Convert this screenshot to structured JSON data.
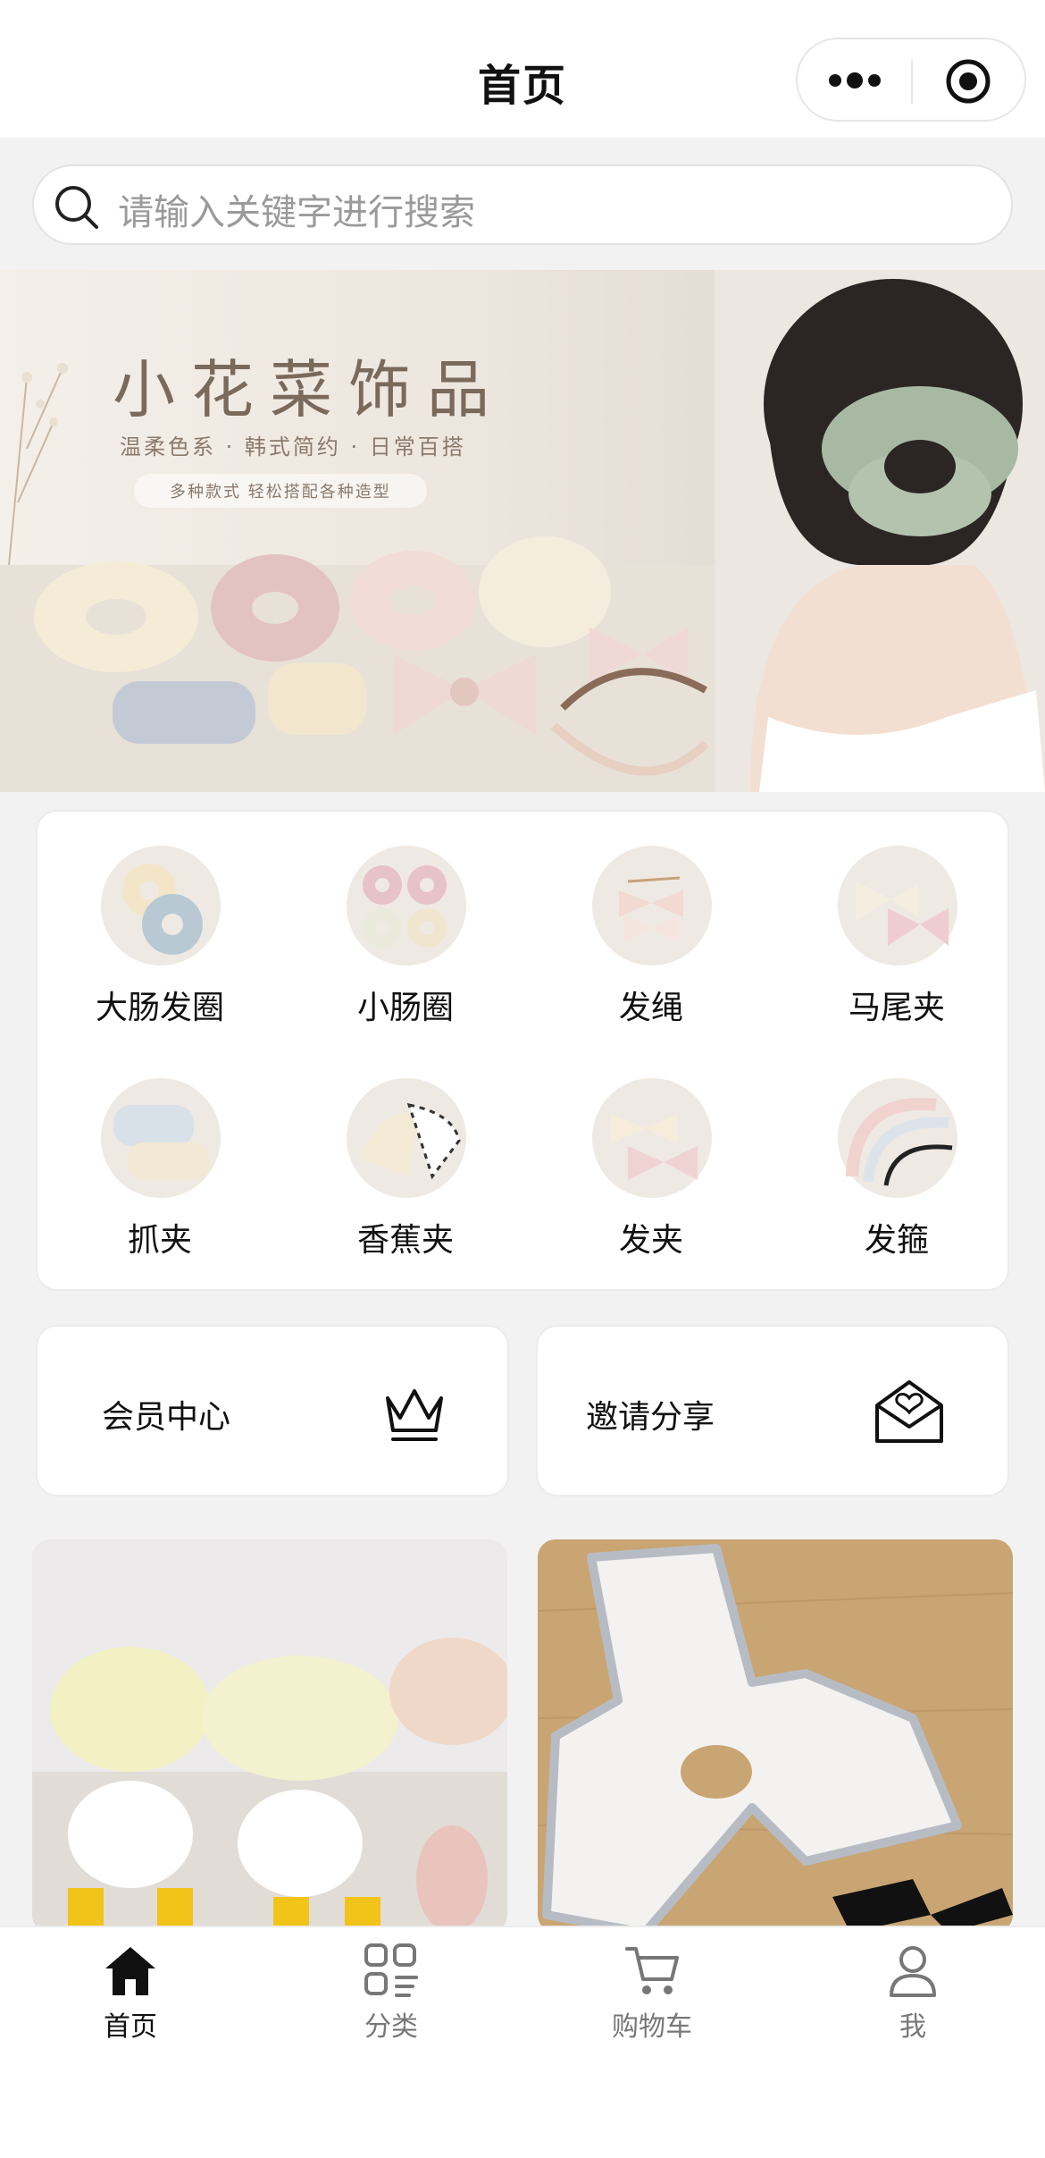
{
  "header": {
    "title": "首页"
  },
  "search": {
    "placeholder": "请输入关键字进行搜索"
  },
  "banner": {
    "title": "小花菜饰品",
    "subtitle": "温柔色系 · 韩式简约 · 日常百搭",
    "tagline": "多种款式  轻松搭配各种造型"
  },
  "categories": [
    {
      "label": "大肠发圈",
      "icon": "scrunchie-thumb"
    },
    {
      "label": "小肠圈",
      "icon": "small-scrunchie-thumb"
    },
    {
      "label": "发绳",
      "icon": "hair-tie-thumb"
    },
    {
      "label": "马尾夹",
      "icon": "ponytail-clip-thumb"
    },
    {
      "label": "抓夹",
      "icon": "claw-clip-thumb"
    },
    {
      "label": "香蕉夹",
      "icon": "banana-clip-thumb"
    },
    {
      "label": "发夹",
      "icon": "hair-clip-thumb"
    },
    {
      "label": "发箍",
      "icon": "headband-thumb"
    }
  ],
  "features": {
    "member": {
      "label": "会员中心",
      "icon": "crown-icon"
    },
    "invite": {
      "label": "邀请分享",
      "icon": "envelope-heart-icon"
    }
  },
  "products": [
    {
      "name": "product-image-flower-clips"
    },
    {
      "name": "product-image-satin-bow"
    }
  ],
  "nav": {
    "items": [
      {
        "label": "首页",
        "icon": "home-icon",
        "active": true
      },
      {
        "label": "分类",
        "icon": "category-icon",
        "active": false
      },
      {
        "label": "购物车",
        "icon": "cart-icon",
        "active": false
      },
      {
        "label": "我",
        "icon": "user-icon",
        "active": false
      }
    ]
  },
  "colors": {
    "accent": "#111111",
    "muted": "#777777",
    "background": "#f2f2f2"
  }
}
